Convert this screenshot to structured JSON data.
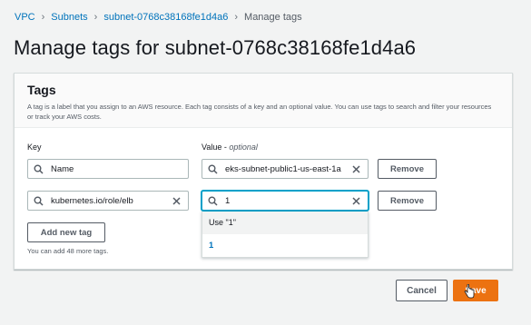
{
  "breadcrumb": {
    "items": [
      "VPC",
      "Subnets",
      "subnet-0768c38168fe1d4a6",
      "Manage tags"
    ],
    "separator": ">"
  },
  "page": {
    "title": "Manage tags for subnet-0768c38168fe1d4a6"
  },
  "tags_panel": {
    "title": "Tags",
    "description": "A tag is a label that you assign to an AWS resource. Each tag consists of a key and an optional value. You can use tags to search and filter your resources or track your AWS costs.",
    "key_label": "Key",
    "value_label": "Value - ",
    "value_label_optional": "optional",
    "rows": [
      {
        "key": "Name",
        "value": "eks-subnet-public1-us-east-1a",
        "remove_label": "Remove"
      },
      {
        "key": "kubernetes.io/role/elb",
        "value": "1",
        "remove_label": "Remove"
      }
    ],
    "suggestions": [
      "Use \"1\"",
      "1"
    ],
    "add_button": "Add new tag",
    "hint": "You can add 48 more tags."
  },
  "footer": {
    "cancel_label": "Cancel",
    "save_label": "Save"
  },
  "colors": {
    "link": "#0073bb",
    "primary": "#ec7211",
    "focus": "#00a1c9"
  },
  "icons": [
    "search-icon",
    "clear-icon",
    "chevron-right-icon",
    "pointer-cursor-icon"
  ]
}
